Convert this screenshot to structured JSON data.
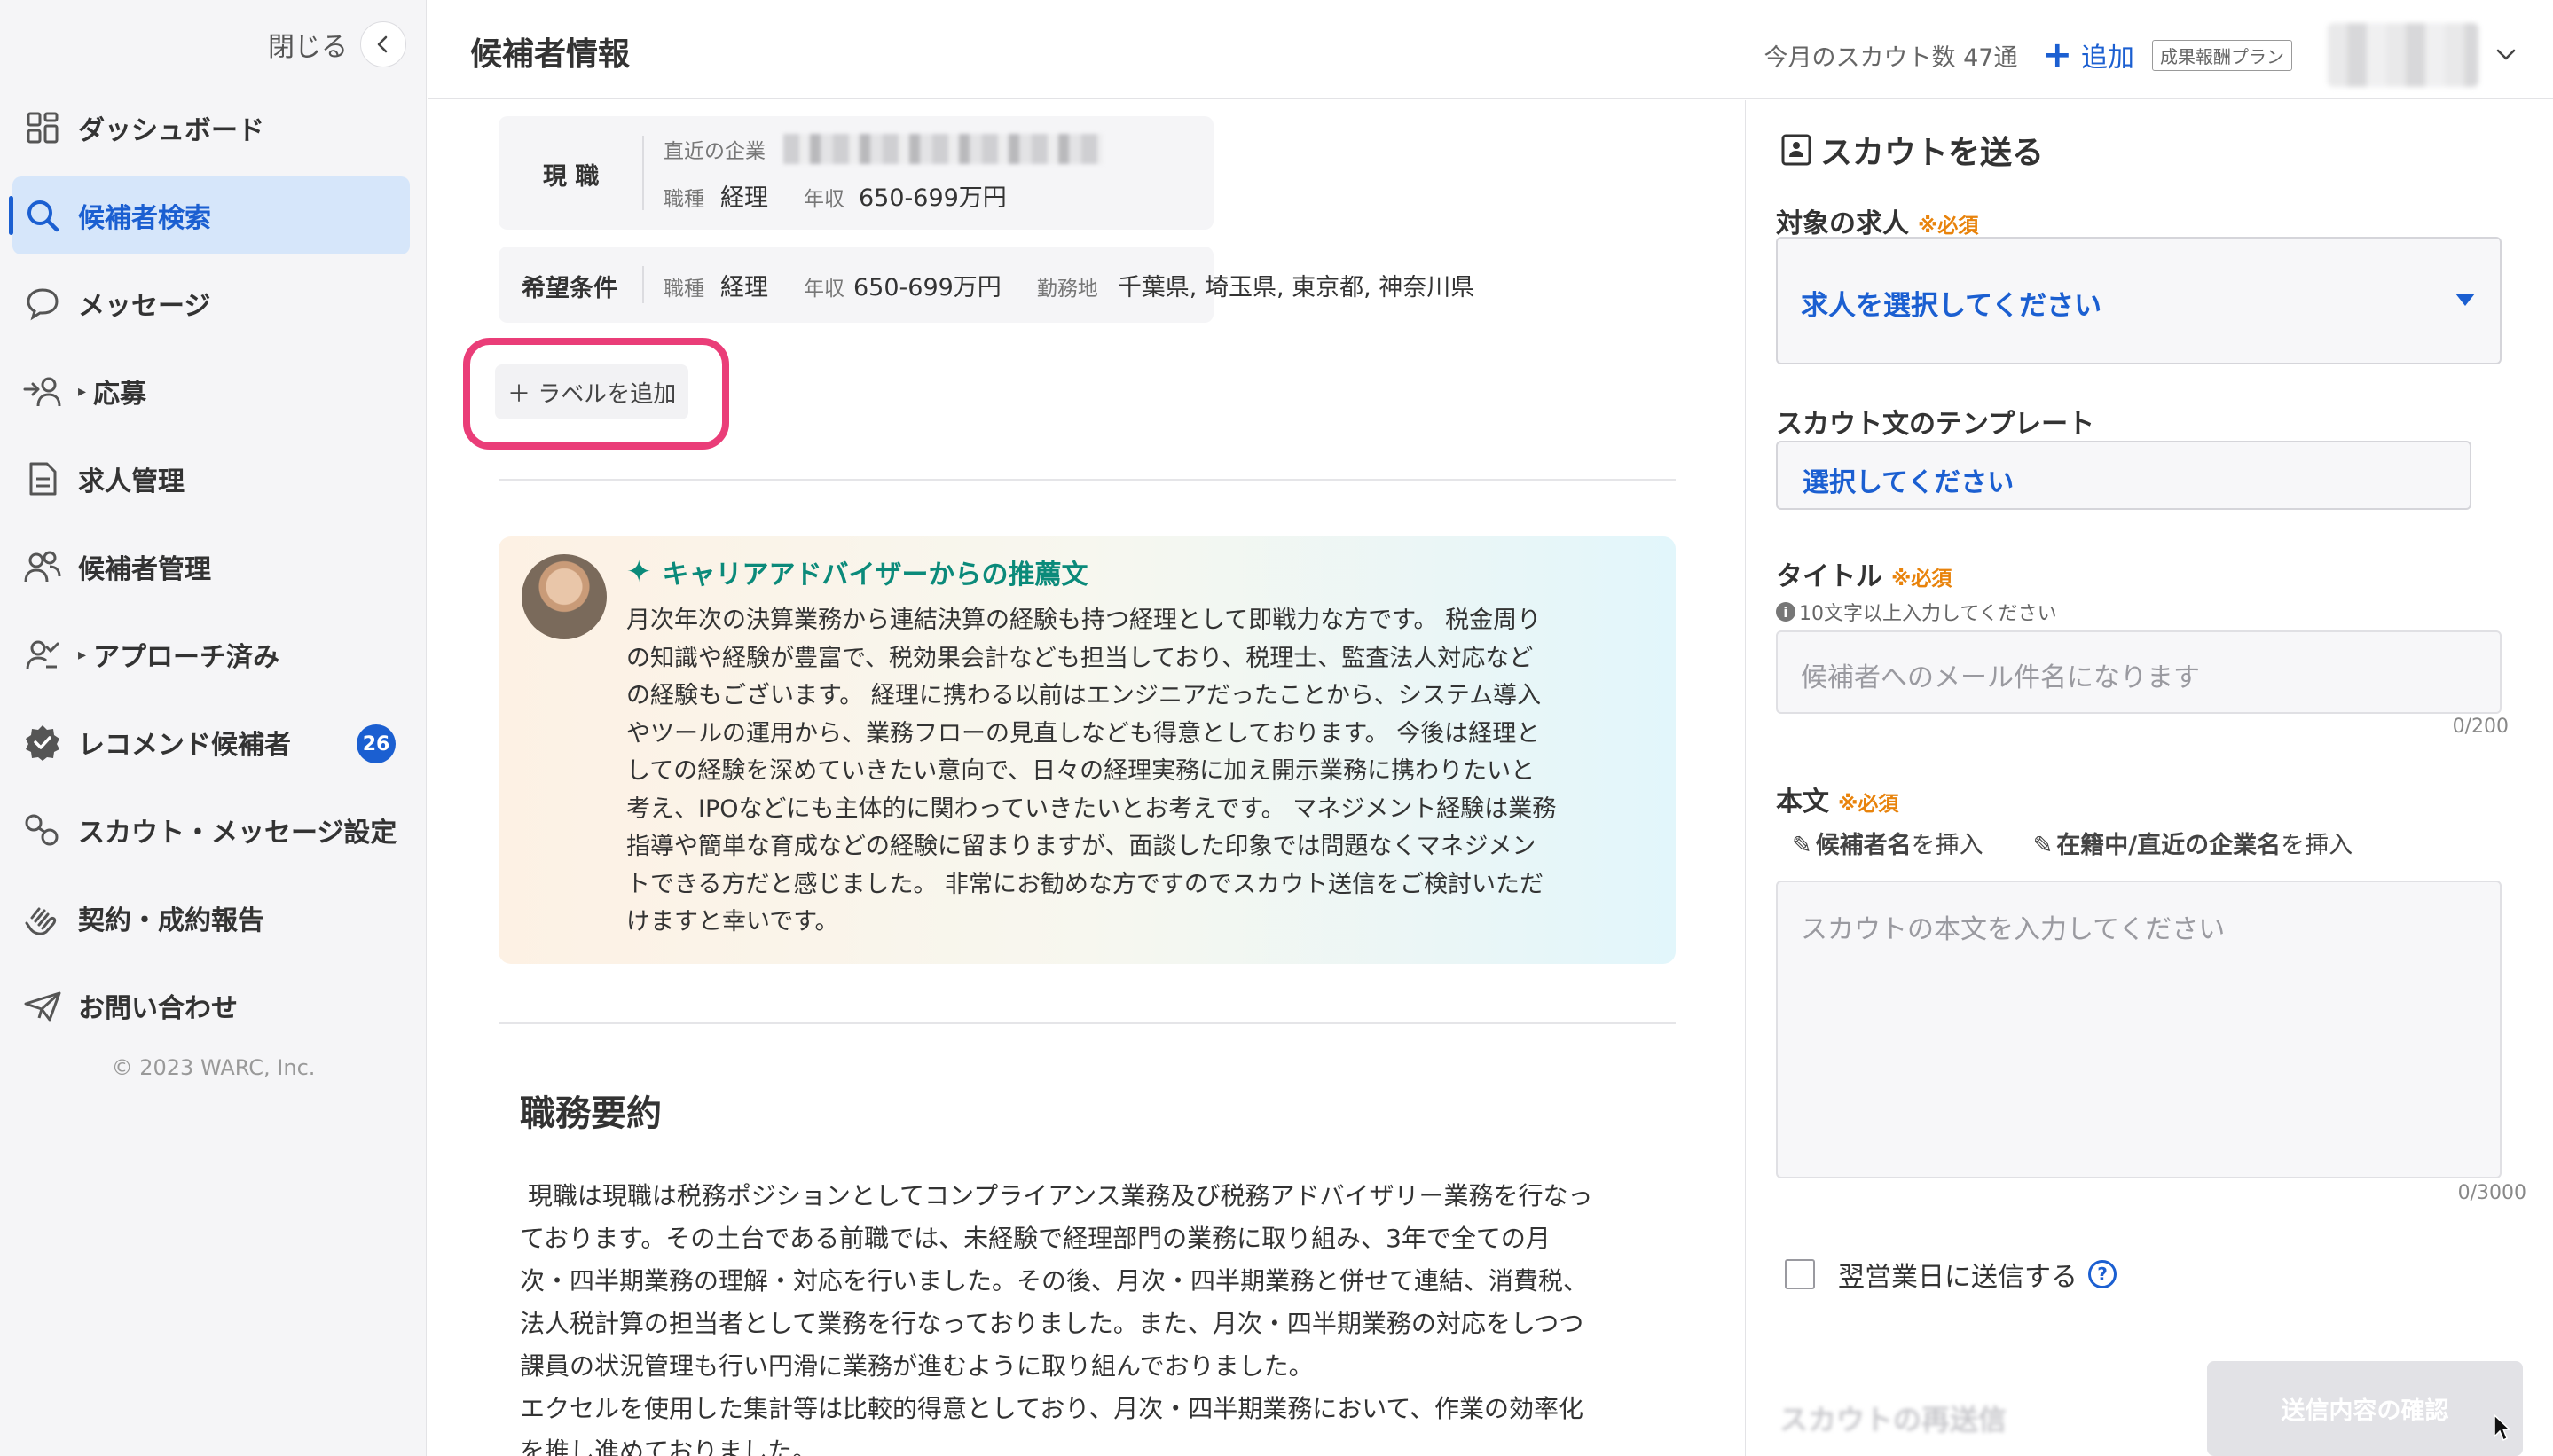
{
  "sidebar": {
    "close_label": "閉じる",
    "items": [
      {
        "label": "ダッシュボード"
      },
      {
        "label": "候補者検索"
      },
      {
        "label": "メッセージ"
      },
      {
        "label": "応募"
      },
      {
        "label": "求人管理"
      },
      {
        "label": "候補者管理"
      },
      {
        "label": "アプローチ済み"
      },
      {
        "label": "レコメンド候補者",
        "badge": "26"
      },
      {
        "label": "スカウト・メッセージ設定"
      },
      {
        "label": "契約・成約報告"
      },
      {
        "label": "お問い合わせ"
      }
    ],
    "copyright": "© 2023 WARC, Inc."
  },
  "header": {
    "title": "候補者情報",
    "scout_count": "今月のスカウト数 47通",
    "add_label": "追加",
    "plan_badge": "成果報酬プラン"
  },
  "profile": {
    "current_head": "現 職",
    "company_label": "直近の企業",
    "job_label": "職種",
    "job_value": "経理",
    "income_label": "年収",
    "income_value": "650-699万円",
    "desired_head": "希望条件",
    "desired_job_label": "職種",
    "desired_job_value": "経理",
    "desired_income_label": "年収",
    "desired_income_value": "650-699万円",
    "location_label": "勤務地",
    "location_value": "千葉県, 埼玉県, 東京都, 神奈川県",
    "add_label_button": "＋ ラベルを追加"
  },
  "recommendation": {
    "title": "キャリアアドバイザーからの推薦文",
    "lines": [
      "月次年次の決算業務から連結決算の経験も持つ経理として即戦力な方です。 税金周り",
      "の知識や経験が豊富で、税効果会計なども担当しており、税理士、監査法人対応など",
      "の経験もございます。 経理に携わる以前はエンジニアだったことから、システム導入",
      "やツールの運用から、業務フローの見直しなども得意としております。 今後は経理と",
      "しての経験を深めていきたい意向で、日々の経理実務に加え開示業務に携わりたいと",
      "考え、IPOなどにも主体的に関わっていきたいとお考えです。 マネジメント経験は業務",
      "指導や簡単な育成などの経験に留まりますが、面談した印象では問題なくマネジメン",
      "トできる方だと感じました。 非常にお勧めな方ですのでスカウト送信をご検討いただ",
      "けますと幸いです。"
    ]
  },
  "summary": {
    "title": "職務要約",
    "lines": [
      " 現職は現職は税務ポジションとしてコンプライアンス業務及び税務アドバイザリー業務を行なっ",
      "ております。その土台である前職では、未経験で経理部門の業務に取り組み、3年で全ての月",
      "次・四半期業務の理解・対応を行いました。その後、月次・四半期業務と併せて連結、消費税、",
      "法人税計算の担当者として業務を行なっておりました。また、月次・四半期業務の対応をしつつ",
      "課員の状況管理も行い円滑に業務が進むように取り組んでおりました。",
      "エクセルを使用した集計等は比較的得意としており、月次・四半期業務において、作業の効率化",
      "を推し進めておりました。"
    ]
  },
  "scout_panel": {
    "title": "スカウトを送る",
    "required": "※必須",
    "job_label": "対象の求人",
    "job_select": "求人を選択してください",
    "template_label": "スカウト文のテンプレート",
    "template_select": "選択してください",
    "title_label": "タイトル",
    "title_hint": "10文字以上入力してください",
    "title_placeholder": "候補者へのメール件名になります",
    "title_counter": "0/200",
    "body_label": "本文",
    "insert_name_bold": "候補者名",
    "insert_name_rest": "を挿入",
    "insert_company_bold": "在籍中/直近の企業名",
    "insert_company_rest": "を挿入",
    "body_placeholder": "スカウトの本文を入力してください",
    "body_counter": "0/3000",
    "next_day_label": "翌営業日に送信する",
    "confirm_button": "送信内容の確認",
    "resend_title": "スカウトの再送信"
  }
}
